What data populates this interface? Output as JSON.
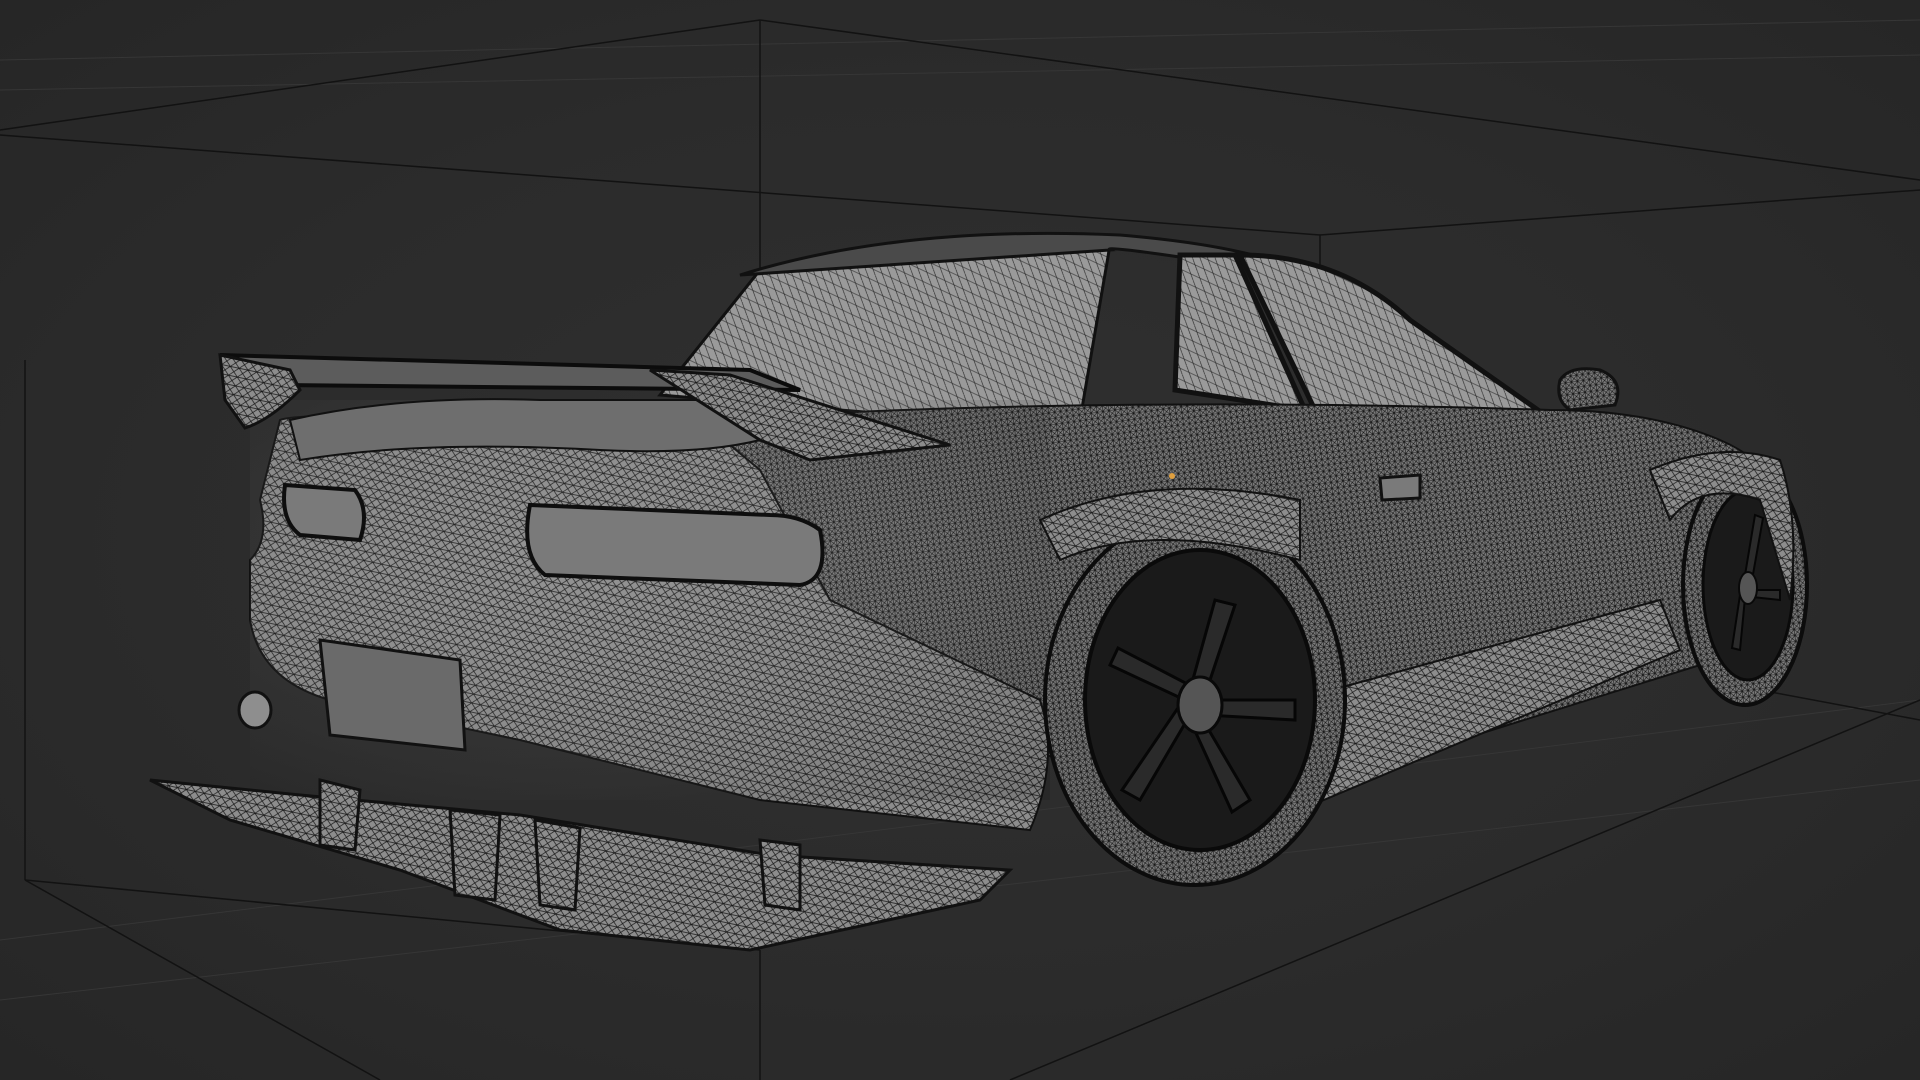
{
  "viewport": {
    "mode": "wireframe",
    "background_color": "#2b2b2b",
    "grid_color": "#3a3a3a",
    "bounds_line_color": "#141414",
    "mesh_fill_color": "#8a8a8a",
    "mesh_wire_color": "#111111",
    "origin_point_color": "#e0a040"
  },
  "scene": {
    "object_icon": "car-mesh-icon"
  }
}
